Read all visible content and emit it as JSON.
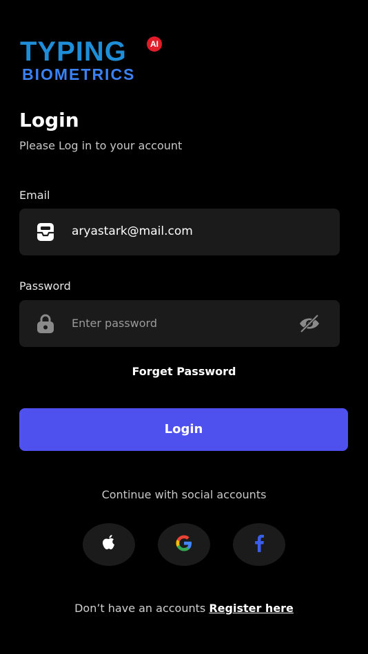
{
  "logo": {
    "line1": "TYPING",
    "line2": "BIOMETRICS",
    "badge": "AI",
    "colors": {
      "primary": "#1f8ed9",
      "badge": "#e11d2a"
    }
  },
  "header": {
    "title": "Login",
    "subtitle": "Please Log in to your account"
  },
  "form": {
    "email": {
      "label": "Email",
      "value": "aryastark@mail.com",
      "icon": "inbox-icon"
    },
    "password": {
      "label": "Password",
      "placeholder": "Enter password",
      "icon": "lock-icon",
      "toggle_icon": "eye-off-icon"
    },
    "forget_label": "Forget Password",
    "submit_label": "Login"
  },
  "social": {
    "caption": "Continue with social accounts",
    "providers": [
      {
        "name": "Apple",
        "icon": "apple-icon"
      },
      {
        "name": "Google",
        "icon": "google-icon"
      },
      {
        "name": "Facebook",
        "icon": "facebook-icon"
      }
    ]
  },
  "footer": {
    "prompt": "Don’t have an accounts",
    "register_label": "Register here"
  },
  "colors": {
    "background": "#000000",
    "field": "#1b1b1b",
    "accent": "#4f51ee"
  }
}
